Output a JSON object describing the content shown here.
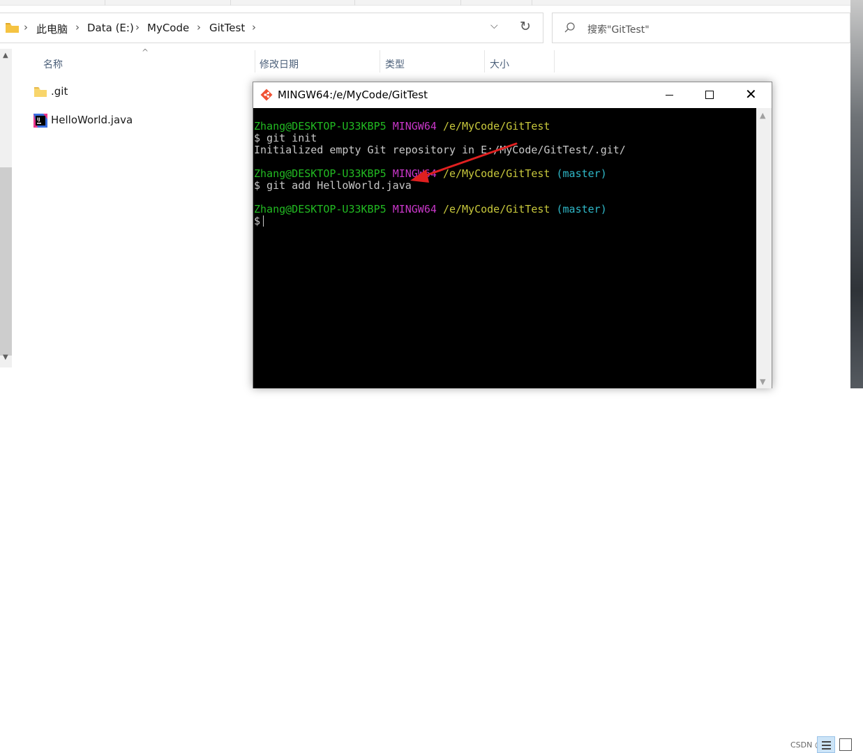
{
  "explorer": {
    "breadcrumb": [
      "此电脑",
      "Data (E:)",
      "MyCode",
      "GitTest"
    ],
    "search": {
      "placeholder": "搜索\"GitTest\""
    },
    "columns": {
      "name": "名称",
      "modified": "修改日期",
      "type": "类型",
      "size": "大小"
    },
    "files": [
      {
        "name": ".git",
        "icon": "folder-icon"
      },
      {
        "name": "HelloWorld.java",
        "icon": "intellij-java-file-icon"
      }
    ],
    "watermark": "CSDN @"
  },
  "terminal": {
    "title": "MINGW64:/e/MyCode/GitTest",
    "lines": [
      {
        "user": "Zhang@DESKTOP-U33KBP5",
        "sys": "MINGW64",
        "path": "/e/MyCode/GitTest",
        "branch": ""
      },
      {
        "text": "$ git init"
      },
      {
        "text": "Initialized empty Git repository in E:/MyCode/GitTest/.git/"
      },
      {
        "user": "Zhang@DESKTOP-U33KBP5",
        "sys": "MINGW64",
        "path": "/e/MyCode/GitTest",
        "branch": "(master)"
      },
      {
        "text": "$ git add HelloWorld.java"
      },
      {
        "user": "Zhang@DESKTOP-U33KBP5",
        "sys": "MINGW64",
        "path": "/e/MyCode/GitTest",
        "branch": "(master)"
      },
      {
        "text": "$"
      }
    ],
    "colors": {
      "user": "#22bb22",
      "sys": "#c837c8",
      "path": "#c8c83c",
      "branch": "#2fb8c8",
      "annotation_arrow": "#e02020"
    }
  }
}
